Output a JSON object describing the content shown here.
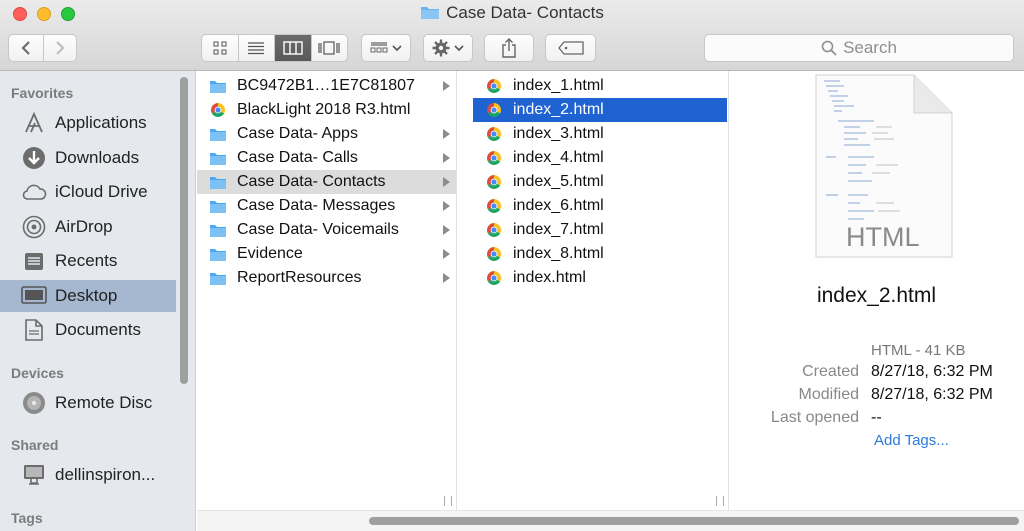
{
  "window": {
    "title": "Case Data- Contacts"
  },
  "toolbar": {
    "back_icon": "chevron-left-icon",
    "forward_icon": "chevron-right-icon",
    "view_modes": [
      "icon-view-icon",
      "list-view-icon",
      "column-view-icon",
      "cover-flow-icon"
    ],
    "active_view": "column-view-icon",
    "search_placeholder": "Search"
  },
  "sidebar": {
    "favorites_title": "Favorites",
    "favorites": [
      {
        "label": "Applications",
        "icon": "applications-icon"
      },
      {
        "label": "Downloads",
        "icon": "downloads-icon"
      },
      {
        "label": "iCloud Drive",
        "icon": "cloud-icon"
      },
      {
        "label": "AirDrop",
        "icon": "airdrop-icon"
      },
      {
        "label": "Recents",
        "icon": "recents-icon"
      },
      {
        "label": "Desktop",
        "icon": "desktop-icon",
        "selected": true
      },
      {
        "label": "Documents",
        "icon": "documents-icon"
      }
    ],
    "devices_title": "Devices",
    "devices": [
      {
        "label": "Remote Disc",
        "icon": "disc-icon"
      }
    ],
    "shared_title": "Shared",
    "shared": [
      {
        "label": "dellinspiron...",
        "icon": "computer-icon"
      }
    ],
    "tags_title": "Tags"
  },
  "column1": {
    "items": [
      {
        "label": "BC9472B1…1E7C81807",
        "icon": "folder-icon",
        "arrow": true
      },
      {
        "label": "BlackLight 2018 R3.html",
        "icon": "chrome-file-icon",
        "arrow": false
      },
      {
        "label": "Case Data- Apps",
        "icon": "folder-icon",
        "arrow": true
      },
      {
        "label": "Case Data- Calls",
        "icon": "folder-icon",
        "arrow": true
      },
      {
        "label": "Case Data- Contacts",
        "icon": "folder-icon",
        "arrow": true,
        "state": "soft"
      },
      {
        "label": "Case Data- Messages",
        "icon": "folder-icon",
        "arrow": true
      },
      {
        "label": "Case Data- Voicemails",
        "icon": "folder-icon",
        "arrow": true
      },
      {
        "label": "Evidence",
        "icon": "folder-icon",
        "arrow": true
      },
      {
        "label": "ReportResources",
        "icon": "folder-icon",
        "arrow": true
      }
    ]
  },
  "column2": {
    "items": [
      {
        "label": "index_1.html",
        "icon": "chrome-file-icon"
      },
      {
        "label": "index_2.html",
        "icon": "chrome-file-icon",
        "state": "selected"
      },
      {
        "label": "index_3.html",
        "icon": "chrome-file-icon"
      },
      {
        "label": "index_4.html",
        "icon": "chrome-file-icon"
      },
      {
        "label": "index_5.html",
        "icon": "chrome-file-icon"
      },
      {
        "label": "index_6.html",
        "icon": "chrome-file-icon"
      },
      {
        "label": "index_7.html",
        "icon": "chrome-file-icon"
      },
      {
        "label": "index_8.html",
        "icon": "chrome-file-icon"
      },
      {
        "label": "index.html",
        "icon": "chrome-file-icon"
      }
    ]
  },
  "preview": {
    "thumb_label": "HTML",
    "name": "index_2.html",
    "kind": "HTML - 41 KB",
    "created_label": "Created",
    "created_value": "8/27/18, 6:32 PM",
    "modified_label": "Modified",
    "modified_value": "8/27/18, 6:32 PM",
    "opened_label": "Last opened",
    "opened_value": "--",
    "add_tags": "Add Tags..."
  },
  "colors": {
    "selection": "#1f63d2",
    "sidebar_selection": "#a6b8d0",
    "link": "#2b7bd7",
    "folder": "#5fb0f0"
  }
}
